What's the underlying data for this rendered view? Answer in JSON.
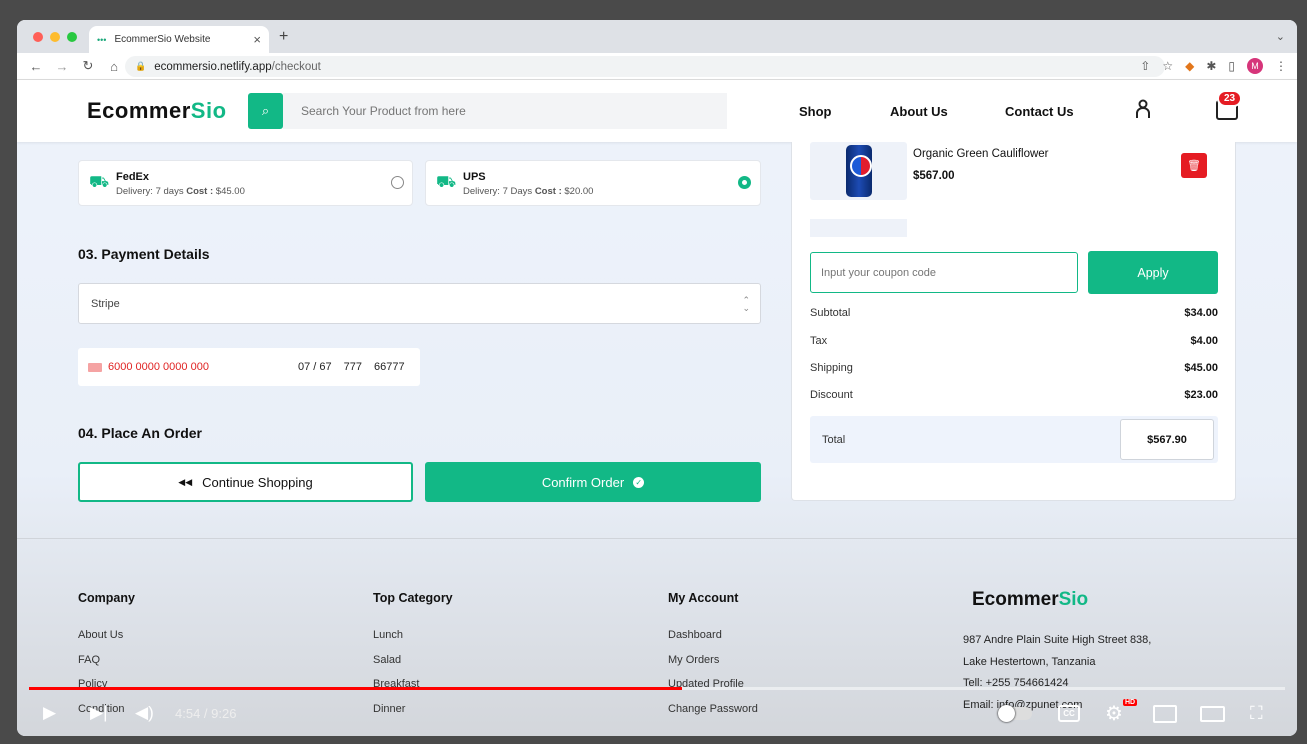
{
  "browser": {
    "tab_title": "EcommerSio Website",
    "url_host": "ecommersio.netlify.app",
    "url_path": "/checkout",
    "profile_initial": "M"
  },
  "header": {
    "logo_main": "Ecommer",
    "logo_accent": "Sio",
    "search_placeholder": "Search Your Product from here",
    "nav": [
      "Shop",
      "About Us",
      "Contact Us"
    ],
    "cart_count": "23"
  },
  "shipping": [
    {
      "name": "FedEx",
      "delivery": "Delivery: 7 days ",
      "cost_label": "Cost :",
      "cost": " $45.00",
      "selected": false
    },
    {
      "name": "UPS",
      "delivery": "Delivery: 7 Days ",
      "cost_label": "Cost :",
      "cost": " $20.00",
      "selected": true
    }
  ],
  "payment": {
    "heading": "03. Payment Details",
    "method": "Stripe",
    "card_number": "6000 0000 0000 000",
    "expiry": "07 / 67",
    "cvc": "777",
    "zip": "66777"
  },
  "order": {
    "heading": "04. Place An Order",
    "continue_label": "Continue Shopping",
    "confirm_label": "Confirm Order"
  },
  "cart": {
    "item_name": "Organic Green Cauliflower",
    "item_price": "$567.00",
    "coupon_placeholder": "Input your coupon code",
    "apply_label": "Apply",
    "summary": [
      {
        "label": "Subtotal",
        "value": "$34.00"
      },
      {
        "label": "Tax",
        "value": "$4.00"
      },
      {
        "label": "Shipping",
        "value": "$45.00"
      },
      {
        "label": "Discount",
        "value": "$23.00"
      }
    ],
    "total_label": "Total",
    "total_value": "$567.90"
  },
  "footer": {
    "columns": [
      {
        "title": "Company",
        "links": [
          "About Us",
          "FAQ",
          "Policy",
          "Condition"
        ]
      },
      {
        "title": "Top Category",
        "links": [
          "Lunch",
          "Salad",
          "Breakfast",
          "Dinner"
        ]
      },
      {
        "title": "My Account",
        "links": [
          "Dashboard",
          "My Orders",
          "Updated Profile",
          "Change Password"
        ]
      }
    ],
    "address_line1": "987 Andre Plain Suite High Street 838,",
    "address_line2": "Lake Hestertown, Tanzania",
    "phone": "Tell: +255 754661424",
    "email": "Email: info@zpunet.com"
  },
  "video": {
    "time": "4:54 / 9:26",
    "progress": 0.52,
    "cc_label": "CC",
    "hd_label": "HD"
  },
  "colors": {
    "accent": "#12b886",
    "danger": "#e51c23"
  }
}
